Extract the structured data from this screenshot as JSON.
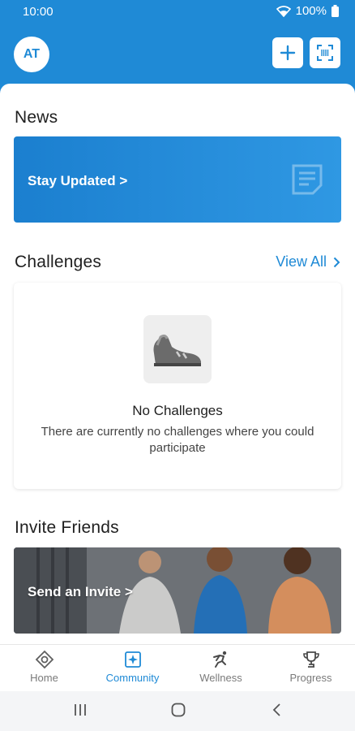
{
  "status_bar": {
    "time": "10:00",
    "battery": "100%"
  },
  "header": {
    "avatar_initials": "AT"
  },
  "news": {
    "title": "News",
    "banner_label": "Stay Updated >"
  },
  "challenges": {
    "title": "Challenges",
    "view_all": "View All",
    "empty_title": "No Challenges",
    "empty_desc": "There are currently no challenges where you could participate"
  },
  "invite": {
    "title": "Invite Friends",
    "banner_label": "Send an Invite >"
  },
  "bottom_nav": {
    "items": [
      {
        "label": "Home",
        "icon": "home-icon"
      },
      {
        "label": "Community",
        "icon": "community-icon",
        "active": true
      },
      {
        "label": "Wellness",
        "icon": "wellness-icon"
      },
      {
        "label": "Progress",
        "icon": "trophy-icon"
      }
    ]
  },
  "colors": {
    "accent": "#1f8ad6",
    "inactive": "#7a7a7a"
  }
}
